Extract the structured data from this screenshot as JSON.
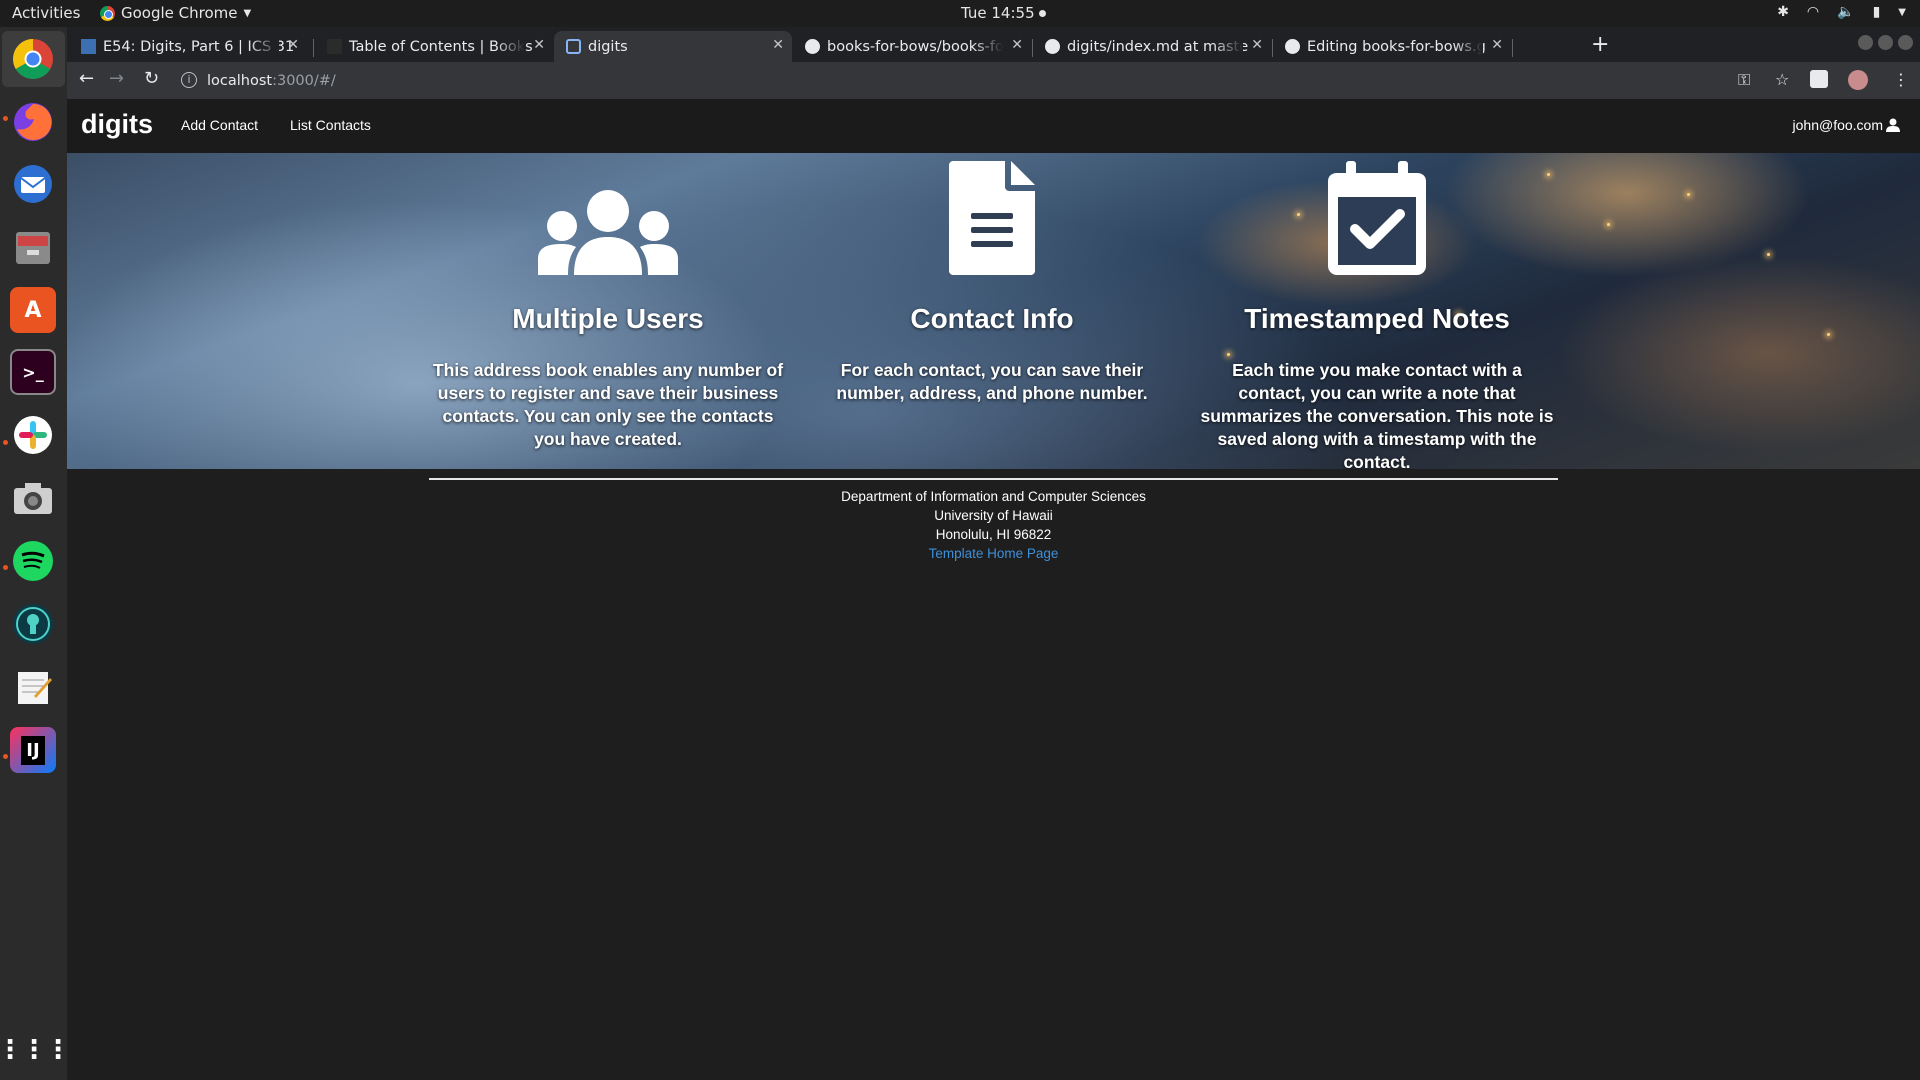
{
  "topbar": {
    "activities": "Activities",
    "app_name": "Google Chrome",
    "clock": "Tue 14:55"
  },
  "dock": {
    "apps": [
      "chrome-icon",
      "firefox-icon",
      "thunderbird-icon",
      "files-icon",
      "software-center-icon",
      "terminal-icon",
      "slack-icon",
      "screenshot-icon",
      "spotify-icon",
      "gitkraken-icon",
      "text-editor-icon",
      "intellij-icon",
      "show-apps-icon"
    ]
  },
  "browser": {
    "tabs": [
      {
        "label": "E54: Digits, Part 6 | ICS 31",
        "active": false
      },
      {
        "label": "Table of Contents | Books",
        "active": false
      },
      {
        "label": "digits",
        "active": true
      },
      {
        "label": "books-for-bows/books-fo",
        "active": false
      },
      {
        "label": "digits/index.md at maste",
        "active": false
      },
      {
        "label": "Editing books-for-bows.g",
        "active": false
      }
    ],
    "url_host": "localhost",
    "url_path": ":3000/#/"
  },
  "site": {
    "brand": "digits",
    "nav": {
      "add_contact": "Add Contact",
      "list_contacts": "List Contacts",
      "user": "john@foo.com"
    },
    "features": [
      {
        "title": "Multiple Users",
        "icon": "users-icon",
        "text": "This address book enables any number of users to register and save their business contacts. You can only see the contacts you have created."
      },
      {
        "title": "Contact Info",
        "icon": "file-alternate-icon",
        "text": "For each contact, you can save their number, address, and phone number."
      },
      {
        "title": "Timestamped Notes",
        "icon": "calendar-check-icon",
        "text": "Each time you make contact with a contact, you can write a note that summarizes the conversation. This note is saved along with a timestamp with the contact."
      }
    ],
    "footer": {
      "line1": "Department of Information and Computer Sciences",
      "line2": "University of Hawaii",
      "line3": "Honolulu, HI 96822",
      "link": "Template Home Page"
    }
  },
  "colors": {
    "link": "#3f8fd8",
    "ubuntu_dot": "#e95420"
  }
}
